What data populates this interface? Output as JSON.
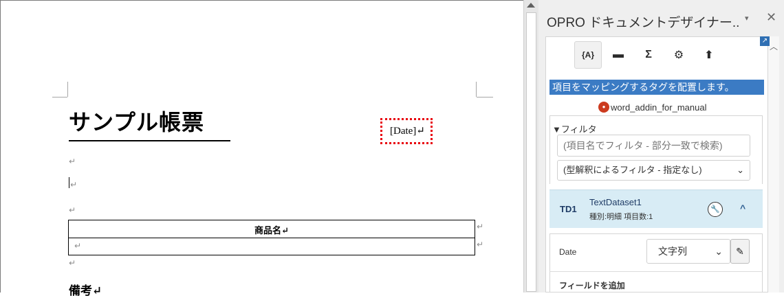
{
  "document": {
    "title": "サンプル帳票",
    "date_placeholder": "[Date]↵",
    "paragraph_mark": "↵",
    "table": {
      "header": "商品名↵"
    },
    "notes_label": "備考↵"
  },
  "task_pane": {
    "title": "OPRO ドキュメントデザイナー..",
    "menu_icon": "▾",
    "close_icon": "✕",
    "toolbar": [
      {
        "name": "mapping-tags",
        "glyph": "{A}"
      },
      {
        "name": "table",
        "glyph": "▬"
      },
      {
        "name": "sum",
        "glyph": "Σ"
      },
      {
        "name": "settings",
        "glyph": "⚙"
      },
      {
        "name": "upload",
        "glyph": "⬆"
      }
    ],
    "info_banner": "項目をマッピングするタグを配置します。",
    "file_name": "word_addin_for_manual",
    "filter": {
      "label": "▼フィルタ",
      "input_placeholder": "(項目名でフィルタ - 部分一致で検索)",
      "select_value": "(型解釈によるフィルタ - 指定なし)"
    },
    "dataset": {
      "code": "TD1",
      "name": "TextDataset1",
      "meta": "種別:明細  項目数:1"
    },
    "field": {
      "name": "Date",
      "type": "文字列"
    },
    "add_field_label": "フィールドを追加"
  }
}
